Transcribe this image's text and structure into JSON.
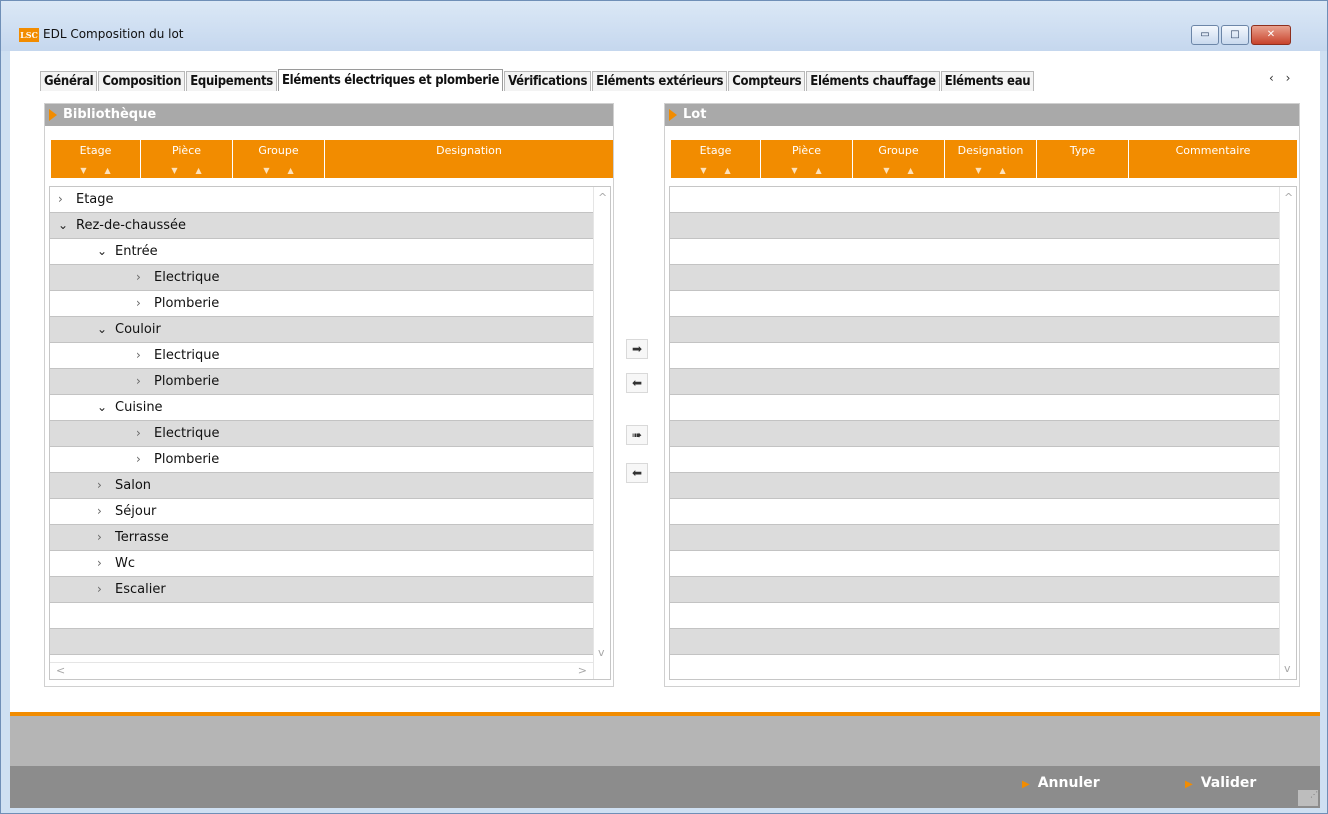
{
  "window": {
    "logo": "LSC",
    "title": "EDL Composition du lot",
    "min_glyph": "▭",
    "max_glyph": "□",
    "close_glyph": "✕"
  },
  "tabs": [
    {
      "label": "Général"
    },
    {
      "label": "Composition"
    },
    {
      "label": "Equipements"
    },
    {
      "label": "Eléments électriques et plomberie",
      "active": true
    },
    {
      "label": "Vérifications"
    },
    {
      "label": "Eléments extérieurs"
    },
    {
      "label": "Compteurs"
    },
    {
      "label": "Eléments chauffage"
    },
    {
      "label": "Eléments eau"
    }
  ],
  "tab_scroll_glyphs": "‹ ›",
  "library": {
    "title": "Bibliothèque",
    "columns": [
      "Etage",
      "Pièce",
      "Groupe",
      "Designation"
    ],
    "tree": [
      {
        "label": "Etage",
        "level": 0,
        "expanded": false
      },
      {
        "label": "Rez-de-chaussée",
        "level": 0,
        "expanded": true
      },
      {
        "label": "Entrée",
        "level": 1,
        "expanded": true
      },
      {
        "label": "Electrique",
        "level": 2,
        "expanded": false
      },
      {
        "label": "Plomberie",
        "level": 2,
        "expanded": false
      },
      {
        "label": "Couloir",
        "level": 1,
        "expanded": true
      },
      {
        "label": "Electrique",
        "level": 2,
        "expanded": false
      },
      {
        "label": "Plomberie",
        "level": 2,
        "expanded": false
      },
      {
        "label": "Cuisine",
        "level": 1,
        "expanded": true
      },
      {
        "label": "Electrique",
        "level": 2,
        "expanded": false
      },
      {
        "label": "Plomberie",
        "level": 2,
        "expanded": false
      },
      {
        "label": "Salon",
        "level": 1,
        "expanded": false
      },
      {
        "label": "Séjour",
        "level": 1,
        "expanded": false
      },
      {
        "label": "Terrasse",
        "level": 1,
        "expanded": false
      },
      {
        "label": "Wc",
        "level": 1,
        "expanded": false
      },
      {
        "label": "Escalier",
        "level": 1,
        "expanded": false
      },
      {
        "label": "",
        "level": 0,
        "empty": true
      },
      {
        "label": "",
        "level": 0,
        "empty": true
      }
    ]
  },
  "lot": {
    "title": "Lot",
    "columns": [
      "Etage",
      "Pièce",
      "Groupe",
      "Designation",
      "Type",
      "Commentaire"
    ],
    "empty_rows": 19
  },
  "move_buttons": [
    {
      "name": "move-right-button",
      "glyph": "➡"
    },
    {
      "name": "move-left-button",
      "glyph": "⬅"
    },
    {
      "name": "move-all-right-button",
      "glyph": "➠"
    },
    {
      "name": "move-all-left-button",
      "glyph": "⬅"
    }
  ],
  "footer": {
    "cancel_label": "Annuler",
    "validate_label": "Valider"
  },
  "colors": {
    "accent": "#f28c00",
    "row_alt": "#dcdcdc",
    "panel_header": "#a9a9a9"
  }
}
